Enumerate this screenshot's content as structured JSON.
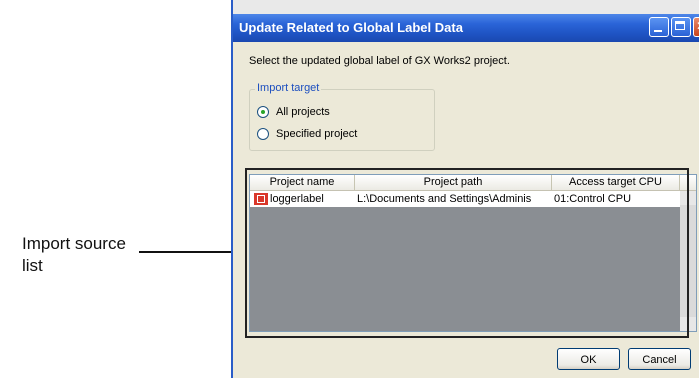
{
  "callout": {
    "line1": "Import source",
    "line2": "list"
  },
  "window": {
    "title": "Update Related to Global Label Data",
    "instruction": "Select the updated global label of GX Works2 project."
  },
  "import_target": {
    "legend": "Import target",
    "options": [
      {
        "label": "All projects",
        "checked": true
      },
      {
        "label": "Specified project",
        "checked": false
      }
    ]
  },
  "list": {
    "columns": [
      "Project name",
      "Project path",
      "Access target CPU"
    ],
    "rows": [
      {
        "project_name": "loggerlabel",
        "project_path": "L:\\Documents and Settings\\Adminis",
        "access_target_cpu": "01:Control CPU",
        "icon": "project-icon"
      }
    ]
  },
  "buttons": {
    "ok": "OK",
    "cancel": "Cancel"
  },
  "colors": {
    "titlebar": "#2a64d8",
    "dialog_bg": "#ece9d8",
    "list_bg": "#8a8e93",
    "legend_text": "#1d4fbf",
    "project_icon": "#d9372a"
  }
}
